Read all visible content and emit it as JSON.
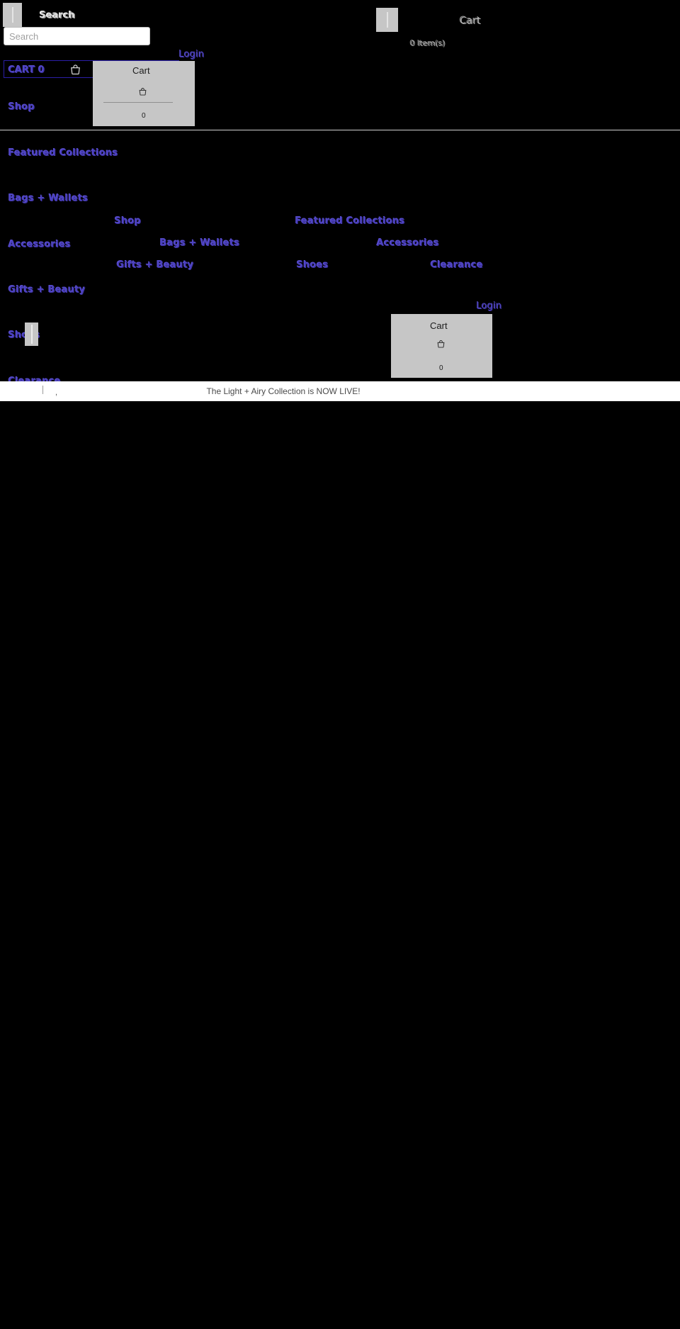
{
  "colors": {
    "background": "#000000",
    "link": "#5a4fcf",
    "link_border": "#2b1fa8",
    "placeholder_box": "#c6c6c6",
    "announcement_bg": "#ffffff",
    "announcement_text": "#4a4a4a",
    "divider": "#cfcfcf"
  },
  "header": {
    "logo_icon": "broken-image-placeholder",
    "search_heading": "Search",
    "search": {
      "placeholder": "Search",
      "value": ""
    },
    "right_logo_icon": "broken-image-placeholder",
    "item_count_label": "0 Item(s)",
    "cart_label_clipped": "Cart",
    "login_label": "Login"
  },
  "cart_toggle": {
    "label": "CART 0",
    "icon": "shopping-bag-icon"
  },
  "cart_panel_top": {
    "title": "Cart",
    "icon": "shopping-bag-icon",
    "count": "0"
  },
  "cart_panel_bottom": {
    "title": "Cart",
    "icon": "shopping-bag-icon",
    "count": "0"
  },
  "nav_left_column": [
    {
      "label": "Shop"
    },
    {
      "label": "Featured Collections"
    },
    {
      "label": "Bags + Wallets"
    },
    {
      "label": "Accessories"
    },
    {
      "label": "Gifts + Beauty"
    },
    {
      "label": "Shoes"
    },
    {
      "label": "Clearance"
    }
  ],
  "nav_overlap_middle": [
    {
      "label": "Shop"
    },
    {
      "label": "Bags + Wallets"
    },
    {
      "label": "Gifts + Beauty"
    }
  ],
  "nav_overlap_right": [
    {
      "label": "Featured Collections"
    },
    {
      "label": "Accessories"
    },
    {
      "label": "Shoes"
    },
    {
      "label": "Clearance"
    }
  ],
  "secondary_login_label": "Login",
  "announcement": {
    "message": "The Light + Airy Collection is NOW LIVE!",
    "separator": ","
  }
}
